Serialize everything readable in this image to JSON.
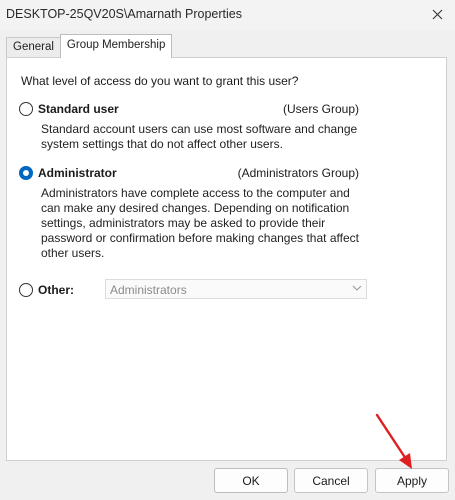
{
  "window": {
    "title": "DESKTOP-25QV20S\\Amarnath Properties"
  },
  "tabs": [
    {
      "label": "General",
      "active": false
    },
    {
      "label": "Group Membership",
      "active": true
    }
  ],
  "group_membership": {
    "question": "What level of access do you want to grant this user?",
    "options": {
      "standard": {
        "label": "Standard user",
        "group": "(Users Group)",
        "selected": false,
        "description": "Standard account users can use most software and change system settings that do not affect other users."
      },
      "administrator": {
        "label": "Administrator",
        "group": "(Administrators Group)",
        "selected": true,
        "description": "Administrators have complete access to the computer and can make any desired changes. Depending on notification settings, administrators may be asked to provide their password or confirmation before making changes that affect other users."
      },
      "other": {
        "label": "Other:",
        "selected": false,
        "dropdown_value": "Administrators"
      }
    }
  },
  "buttons": {
    "ok": "OK",
    "cancel": "Cancel",
    "apply": "Apply"
  },
  "colors": {
    "accent": "#0067c0",
    "annotation_arrow": "#e02020"
  }
}
